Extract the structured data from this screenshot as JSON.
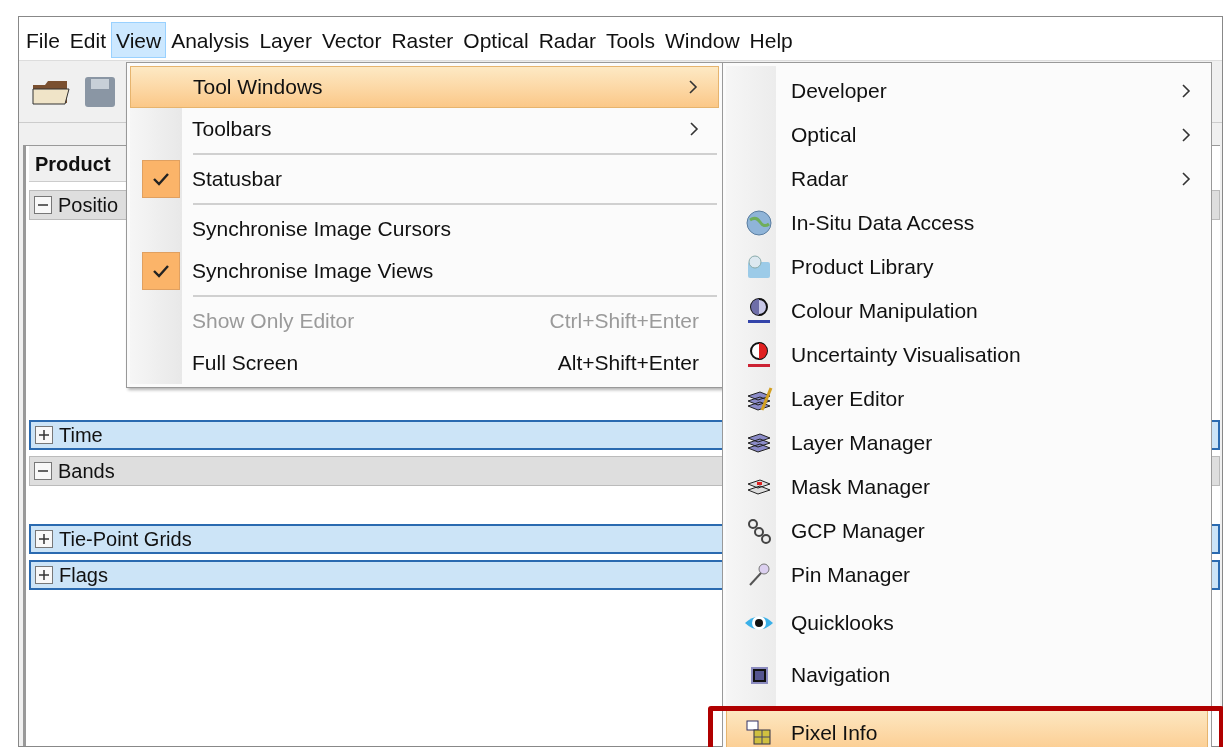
{
  "menubar": [
    {
      "label": "File",
      "selected": false
    },
    {
      "label": "Edit",
      "selected": false
    },
    {
      "label": "View",
      "selected": true
    },
    {
      "label": "Analysis",
      "selected": false
    },
    {
      "label": "Layer",
      "selected": false
    },
    {
      "label": "Vector",
      "selected": false
    },
    {
      "label": "Raster",
      "selected": false
    },
    {
      "label": "Optical",
      "selected": false
    },
    {
      "label": "Radar",
      "selected": false
    },
    {
      "label": "Tools",
      "selected": false
    },
    {
      "label": "Window",
      "selected": false
    },
    {
      "label": "Help",
      "selected": false
    }
  ],
  "product_panel": {
    "title": "Product",
    "sections": [
      {
        "label": "Positio",
        "expanded": true
      },
      {
        "label": "Time",
        "expanded": false
      },
      {
        "label": "Bands",
        "expanded": true
      },
      {
        "label": "Tie-Point Grids",
        "expanded": false
      },
      {
        "label": "Flags",
        "expanded": false
      }
    ]
  },
  "view_menu": [
    {
      "kind": "submenu",
      "label": "Tool Windows",
      "selected": true
    },
    {
      "kind": "submenu",
      "label": "Toolbars",
      "selected": false
    },
    {
      "kind": "separator"
    },
    {
      "kind": "check",
      "label": "Statusbar",
      "checked": true
    },
    {
      "kind": "separator"
    },
    {
      "kind": "check",
      "label": "Synchronise Image Cursors",
      "checked": false
    },
    {
      "kind": "check",
      "label": "Synchronise Image Views",
      "checked": true
    },
    {
      "kind": "separator"
    },
    {
      "kind": "item",
      "label": "Show Only Editor",
      "shortcut": "Ctrl+Shift+Enter",
      "disabled": true
    },
    {
      "kind": "item",
      "label": "Full Screen",
      "shortcut": "Alt+Shift+Enter",
      "disabled": false
    }
  ],
  "tool_windows_menu": [
    {
      "kind": "submenu",
      "label": "Developer",
      "selected": false,
      "annotated": false
    },
    {
      "kind": "submenu",
      "label": "Optical",
      "selected": false,
      "annotated": false
    },
    {
      "kind": "submenu",
      "label": "Radar",
      "selected": false,
      "annotated": false
    },
    {
      "kind": "tool",
      "label": "In-Situ Data Access",
      "selected": false,
      "annotated": false
    },
    {
      "kind": "tool",
      "label": "Product Library",
      "selected": false,
      "annotated": false
    },
    {
      "kind": "tool",
      "label": "Colour Manipulation",
      "selected": false,
      "annotated": false
    },
    {
      "kind": "tool",
      "label": "Uncertainty Visualisation",
      "selected": false,
      "annotated": false
    },
    {
      "kind": "tool",
      "label": "Layer Editor",
      "selected": false,
      "annotated": false
    },
    {
      "kind": "tool",
      "label": "Layer Manager",
      "selected": false,
      "annotated": false
    },
    {
      "kind": "tool",
      "label": "Mask Manager",
      "selected": false,
      "annotated": false
    },
    {
      "kind": "tool",
      "label": "GCP Manager",
      "selected": false,
      "annotated": false
    },
    {
      "kind": "tool",
      "label": "Pin Manager",
      "selected": false,
      "annotated": false
    },
    {
      "kind": "tool",
      "label": "Quicklooks",
      "selected": false,
      "annotated": false
    },
    {
      "kind": "tool",
      "label": "Navigation",
      "selected": false,
      "annotated": false
    },
    {
      "kind": "tool",
      "label": "Pixel Info",
      "selected": true,
      "annotated": true
    }
  ]
}
